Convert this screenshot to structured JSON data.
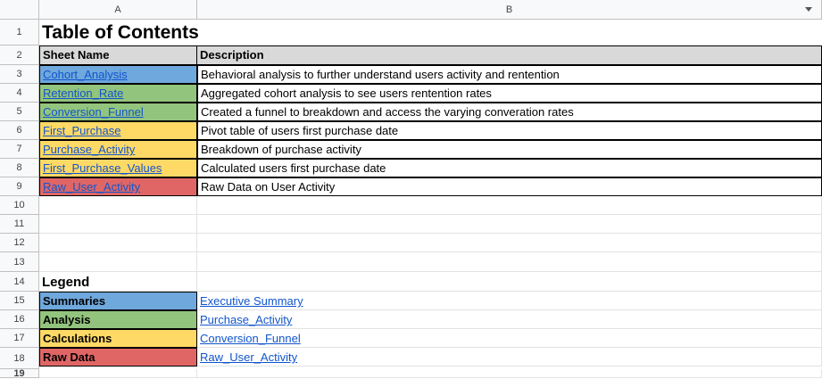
{
  "columns": [
    "A",
    "B"
  ],
  "row_numbers": [
    "1",
    "2",
    "3",
    "4",
    "5",
    "6",
    "7",
    "8",
    "9",
    "10",
    "11",
    "12",
    "13",
    "14",
    "15",
    "16",
    "17",
    "18",
    "19"
  ],
  "title": "Table of Contents",
  "headers": {
    "sheet_name": "Sheet Name",
    "description": "Description"
  },
  "toc": [
    {
      "sheet": "Cohort_Analysis",
      "desc": "Behavioral analysis to further understand users activity and rentention",
      "color": "#6fa8dc"
    },
    {
      "sheet": "Retention_Rate",
      "desc": "Aggregated cohort analysis to see users rentention rates",
      "color": "#93c47d"
    },
    {
      "sheet": "Conversion_Funnel",
      "desc": "Created a funnel to breakdown and access the varying converation rates",
      "color": "#93c47d"
    },
    {
      "sheet": "First_Purchase",
      "desc": "Pivot table of users first purchase date",
      "color": "#ffd966"
    },
    {
      "sheet": "Purchase_Activity",
      "desc": "Breakdown of purchase activity",
      "color": "#ffd966"
    },
    {
      "sheet": "First_Purchase_Values",
      "desc": "Calculated users first purchase date",
      "color": "#ffd966"
    },
    {
      "sheet": "Raw_User_Activity",
      "desc": "Raw Data on User Activity",
      "color": "#e06666"
    }
  ],
  "legend_title": "Legend",
  "legend": [
    {
      "label": "Summaries",
      "link": "Executive Summary",
      "color": "#6fa8dc"
    },
    {
      "label": "Analysis",
      "link": "Purchase_Activity",
      "color": "#93c47d"
    },
    {
      "label": "Calculations",
      "link": "Conversion_Funnel",
      "color": "#ffd966"
    },
    {
      "label": "Raw Data",
      "link": "Raw_User_Activity",
      "color": "#e06666"
    }
  ],
  "header_bg": "#d9d9d9"
}
